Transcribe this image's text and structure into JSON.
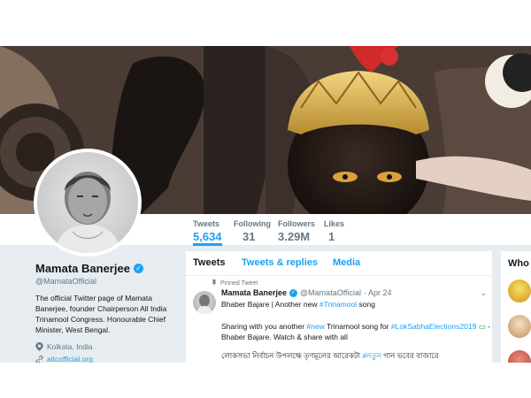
{
  "stats": [
    {
      "label": "Tweets",
      "value": "5,634",
      "active": true
    },
    {
      "label": "Following",
      "value": "31",
      "active": false
    },
    {
      "label": "Followers",
      "value": "3.29M",
      "active": false
    },
    {
      "label": "Likes",
      "value": "1",
      "active": false
    }
  ],
  "profile": {
    "name": "Mamata Banerjee",
    "handle": "@MamataOfficial",
    "bio": "The official Twitter page of Mamata Banerjee, founder Chairperson All India Trinamool Congress. Honourable Chief Minister, West Bengal.",
    "location": "Kolkata, India",
    "link": "aitcofficial.org"
  },
  "timeline": {
    "tabs": [
      "Tweets",
      "Tweets & replies",
      "Media"
    ],
    "pinned_label": "Pinned Tweet",
    "tweet": {
      "name": "Mamata Banerjee",
      "handle": "@MamataOfficial",
      "date": "· Apr 24",
      "line1": "Bhaber Bajare | Another new",
      "line1_hash": "#Trinamool",
      "line1_end": "song",
      "line2_start": "Sharing with you another",
      "line2_hash1": "#new",
      "line2_mid": "Trinamool song for",
      "line2_hash2": "#LokSabhaElections2019",
      "line2_end": "-",
      "line3": "Bhaber Bajare. Watch & share with all",
      "line4_start": "লোকসভা নির্বাচন উপলক্ষে তৃণমূলের আরেকটা",
      "line4_hash": "#নতুন",
      "line4_end": "গান ভবের বাজারে"
    }
  },
  "who": {
    "title": "Who"
  },
  "colors": {
    "accent": "#1da1f2",
    "verified": "#1da1f2",
    "page_bg": "#e6ecf0"
  }
}
